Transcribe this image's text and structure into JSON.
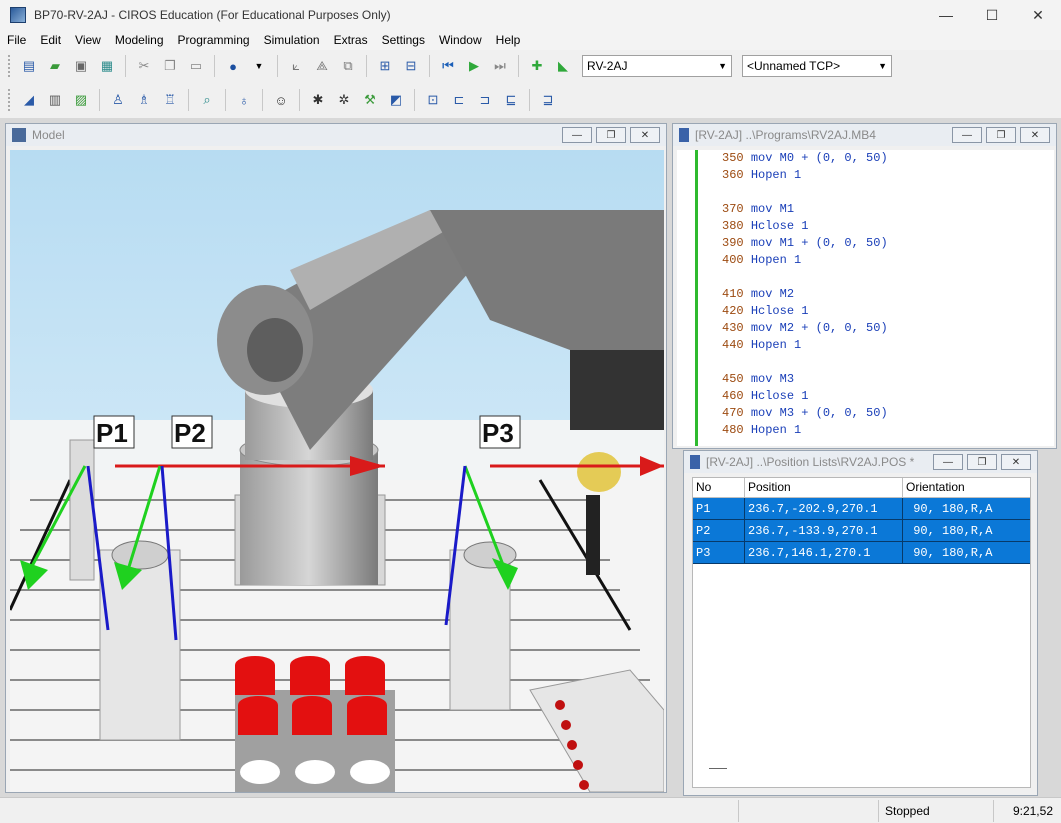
{
  "window": {
    "title": "BP70-RV-2AJ - CIROS Education (For Educational Purposes Only)",
    "minimize": "—",
    "maximize": "☐",
    "close": "✕"
  },
  "menu": [
    "File",
    "Edit",
    "View",
    "Modeling",
    "Programming",
    "Simulation",
    "Extras",
    "Settings",
    "Window",
    "Help"
  ],
  "toolbar": {
    "robot_combo": "RV-2AJ",
    "tcp_combo": "<Unnamed TCP>"
  },
  "model_window": {
    "title": "Model",
    "labels": [
      "P1",
      "P2",
      "P3"
    ]
  },
  "program_window": {
    "title": "[RV-2AJ] ..\\Programs\\RV2AJ.MB4",
    "lines": [
      {
        "n": "350",
        "cmd": "mov",
        "arg": "M0 + (0, 0, 50)"
      },
      {
        "n": "360",
        "cmd": "Hopen",
        "arg": "1"
      },
      {
        "n": "",
        "cmd": "",
        "arg": ""
      },
      {
        "n": "370",
        "cmd": "mov",
        "arg": "M1"
      },
      {
        "n": "380",
        "cmd": "Hclose",
        "arg": "1"
      },
      {
        "n": "390",
        "cmd": "mov",
        "arg": "M1 + (0, 0, 50)"
      },
      {
        "n": "400",
        "cmd": "Hopen",
        "arg": "1"
      },
      {
        "n": "",
        "cmd": "",
        "arg": ""
      },
      {
        "n": "410",
        "cmd": "mov",
        "arg": "M2"
      },
      {
        "n": "420",
        "cmd": "Hclose",
        "arg": "1"
      },
      {
        "n": "430",
        "cmd": "mov",
        "arg": "M2 + (0, 0, 50)"
      },
      {
        "n": "440",
        "cmd": "Hopen",
        "arg": "1"
      },
      {
        "n": "",
        "cmd": "",
        "arg": ""
      },
      {
        "n": "450",
        "cmd": "mov",
        "arg": "M3"
      },
      {
        "n": "460",
        "cmd": "Hclose",
        "arg": "1"
      },
      {
        "n": "470",
        "cmd": "mov",
        "arg": "M3 + (0, 0, 50)"
      },
      {
        "n": "480",
        "cmd": "Hopen",
        "arg": "1"
      }
    ]
  },
  "position_window": {
    "title": "[RV-2AJ] ..\\Position Lists\\RV2AJ.POS *",
    "columns": [
      "No",
      "Position",
      "Orientation"
    ],
    "rows": [
      {
        "no": "P1",
        "position": "236.7,-202.9,270.1",
        "orientation": " 90, 180,R,A"
      },
      {
        "no": "P2",
        "position": "236.7,-133.9,270.1",
        "orientation": " 90, 180,R,A"
      },
      {
        "no": "P3",
        "position": "236.7,146.1,270.1",
        "orientation": " 90, 180,R,A"
      }
    ]
  },
  "status": {
    "state": "Stopped",
    "time": "9:21,52"
  }
}
